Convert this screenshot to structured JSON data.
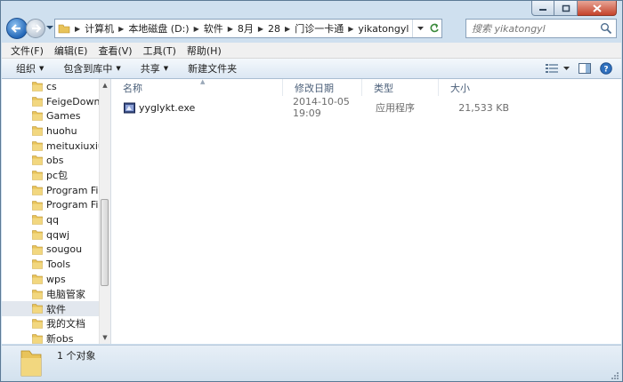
{
  "window": {
    "caption_buttons": {
      "minimize": "minimize-icon",
      "maximize": "maximize-icon",
      "close": "close-icon"
    }
  },
  "address_bar": {
    "crumbs": [
      "计算机",
      "本地磁盘 (D:)",
      "软件",
      "8月",
      "28",
      "门诊一卡通",
      "yikatongyl"
    ]
  },
  "search": {
    "placeholder": "搜索 yikatongyl"
  },
  "menu": [
    "文件(F)",
    "编辑(E)",
    "查看(V)",
    "工具(T)",
    "帮助(H)"
  ],
  "commands": {
    "organize": "组织",
    "include_library": "包含到库中",
    "share": "共享",
    "new_folder": "新建文件夹"
  },
  "tree": {
    "items": [
      "cs",
      "FeigeDownloa",
      "Games",
      "huohu",
      "meituxiuxiu",
      "obs",
      "pc包",
      "Program Files",
      "Program Files",
      "qq",
      "qqwj",
      "sougou",
      "Tools",
      "wps",
      "电脑管家",
      "软件",
      "我的文档",
      "新obs"
    ],
    "selected_index": 15
  },
  "columns": {
    "name": "名称",
    "date": "修改日期",
    "type": "类型",
    "size": "大小"
  },
  "files": [
    {
      "name": "yyglykt.exe",
      "date": "2014-10-05 19:09",
      "type": "应用程序",
      "size": "21,533 KB"
    }
  ],
  "status": {
    "text": "1 个对象"
  },
  "colors": {
    "folder": "#e8c35a",
    "selection": "#e2e7ee",
    "header_text": "#4c607a"
  }
}
